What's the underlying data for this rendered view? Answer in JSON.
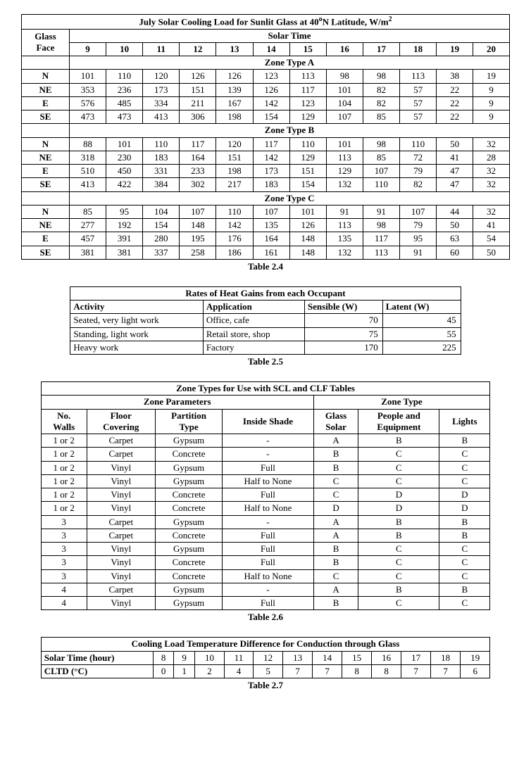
{
  "table24": {
    "title_prefix": "July Solar Cooling Load for Sunlit Glass at 40",
    "title_deg": "o",
    "title_suffix": "N Latitude, W/m",
    "title_exp": "2",
    "glass_face_h1": "Glass",
    "glass_face_h2": "Face",
    "solar_time": "Solar Time",
    "hours": [
      "9",
      "10",
      "11",
      "12",
      "13",
      "14",
      "15",
      "16",
      "17",
      "18",
      "19",
      "20"
    ],
    "zoneA": "Zone Type A",
    "zoneB": "Zone Type B",
    "zoneC": "Zone Type C",
    "faces": [
      "N",
      "NE",
      "E",
      "SE"
    ],
    "A": {
      "N": [
        "101",
        "110",
        "120",
        "126",
        "126",
        "123",
        "113",
        "98",
        "98",
        "113",
        "38",
        "19"
      ],
      "NE": [
        "353",
        "236",
        "173",
        "151",
        "139",
        "126",
        "117",
        "101",
        "82",
        "57",
        "22",
        "9"
      ],
      "E": [
        "576",
        "485",
        "334",
        "211",
        "167",
        "142",
        "123",
        "104",
        "82",
        "57",
        "22",
        "9"
      ],
      "SE": [
        "473",
        "473",
        "413",
        "306",
        "198",
        "154",
        "129",
        "107",
        "85",
        "57",
        "22",
        "9"
      ]
    },
    "B": {
      "N": [
        "88",
        "101",
        "110",
        "117",
        "120",
        "117",
        "110",
        "101",
        "98",
        "110",
        "50",
        "32"
      ],
      "NE": [
        "318",
        "230",
        "183",
        "164",
        "151",
        "142",
        "129",
        "113",
        "85",
        "72",
        "41",
        "28"
      ],
      "E": [
        "510",
        "450",
        "331",
        "233",
        "198",
        "173",
        "151",
        "129",
        "107",
        "79",
        "47",
        "32"
      ],
      "SE": [
        "413",
        "422",
        "384",
        "302",
        "217",
        "183",
        "154",
        "132",
        "110",
        "82",
        "47",
        "32"
      ]
    },
    "C": {
      "N": [
        "85",
        "95",
        "104",
        "107",
        "110",
        "107",
        "101",
        "91",
        "91",
        "107",
        "44",
        "32"
      ],
      "NE": [
        "277",
        "192",
        "154",
        "148",
        "142",
        "135",
        "126",
        "113",
        "98",
        "79",
        "50",
        "41"
      ],
      "E": [
        "457",
        "391",
        "280",
        "195",
        "176",
        "164",
        "148",
        "135",
        "117",
        "95",
        "63",
        "54"
      ],
      "SE": [
        "381",
        "381",
        "337",
        "258",
        "186",
        "161",
        "148",
        "132",
        "113",
        "91",
        "60",
        "50"
      ]
    },
    "caption": "Table 2.4"
  },
  "table25": {
    "title": "Rates of Heat Gains from each Occupant",
    "headers": [
      "Activity",
      "Application",
      "Sensible (W)",
      "Latent (W)"
    ],
    "rows": [
      [
        "Seated, very light work",
        "Office, cafe",
        "70",
        "45"
      ],
      [
        "Standing, light work",
        "Retail store, shop",
        "75",
        "55"
      ],
      [
        "Heavy work",
        "Factory",
        "170",
        "225"
      ]
    ],
    "caption": "Table 2.5"
  },
  "table26": {
    "title": "Zone Types for Use with SCL and CLF Tables",
    "group1": "Zone Parameters",
    "group2": "Zone Type",
    "headers": [
      "No. Walls",
      "Floor Covering",
      "Partition Type",
      "Inside Shade",
      "Glass Solar",
      "People and Equipment",
      "Lights"
    ],
    "h_no": "No.",
    "h_walls": "Walls",
    "h_floor": "Floor",
    "h_covering": "Covering",
    "h_partition": "Partition",
    "h_type": "Type",
    "h_inside_shade": "Inside Shade",
    "h_glass": "Glass",
    "h_solar": "Solar",
    "h_people": "People and",
    "h_equipment": "Equipment",
    "h_lights": "Lights",
    "rows": [
      [
        "1 or 2",
        "Carpet",
        "Gypsum",
        "-",
        "A",
        "B",
        "B"
      ],
      [
        "1 or 2",
        "Carpet",
        "Concrete",
        "-",
        "B",
        "C",
        "C"
      ],
      [
        "1 or 2",
        "Vinyl",
        "Gypsum",
        "Full",
        "B",
        "C",
        "C"
      ],
      [
        "1 or 2",
        "Vinyl",
        "Gypsum",
        "Half to None",
        "C",
        "C",
        "C"
      ],
      [
        "1 or 2",
        "Vinyl",
        "Concrete",
        "Full",
        "C",
        "D",
        "D"
      ],
      [
        "1 or 2",
        "Vinyl",
        "Concrete",
        "Half to None",
        "D",
        "D",
        "D"
      ],
      [
        "3",
        "Carpet",
        "Gypsum",
        "-",
        "A",
        "B",
        "B"
      ],
      [
        "3",
        "Carpet",
        "Concrete",
        "Full",
        "A",
        "B",
        "B"
      ],
      [
        "3",
        "Vinyl",
        "Gypsum",
        "Full",
        "B",
        "C",
        "C"
      ],
      [
        "3",
        "Vinyl",
        "Concrete",
        "Full",
        "B",
        "C",
        "C"
      ],
      [
        "3",
        "Vinyl",
        "Concrete",
        "Half to None",
        "C",
        "C",
        "C"
      ],
      [
        "4",
        "Carpet",
        "Gypsum",
        "-",
        "A",
        "B",
        "B"
      ],
      [
        "4",
        "Vinyl",
        "Gypsum",
        "Full",
        "B",
        "C",
        "C"
      ]
    ],
    "caption": "Table 2.6"
  },
  "table27": {
    "title": "Cooling Load Temperature Difference for Conduction through Glass",
    "row1_label": "Solar Time (hour)",
    "row2_label": "CLTD (°C)",
    "hours": [
      "8",
      "9",
      "10",
      "11",
      "12",
      "13",
      "14",
      "15",
      "16",
      "17",
      "18",
      "19"
    ],
    "values": [
      "0",
      "1",
      "2",
      "4",
      "5",
      "7",
      "7",
      "8",
      "8",
      "7",
      "7",
      "6"
    ],
    "caption": "Table 2.7"
  }
}
